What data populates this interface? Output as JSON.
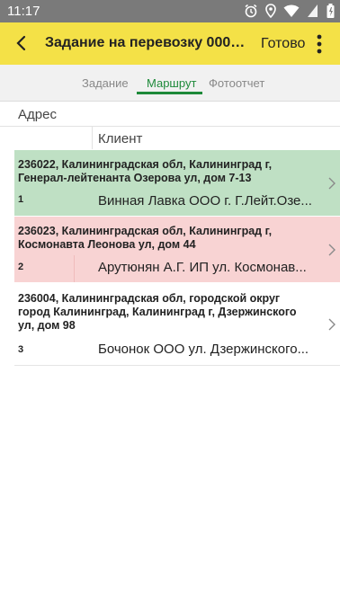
{
  "status_bar": {
    "time": "11:17",
    "icons": [
      "alarm-icon",
      "location-icon",
      "wifi-icon",
      "no-sim-icon",
      "battery-icon"
    ]
  },
  "app_bar": {
    "back_icon": "arrow-left-icon",
    "title": "Задание на перевозку 00000...",
    "done_label": "Готово",
    "menu_icon": "more-vert-icon"
  },
  "tabs": [
    {
      "label": "Задание",
      "active": false
    },
    {
      "label": "Маршрут",
      "active": true
    },
    {
      "label": "Фотоотчет",
      "active": false
    }
  ],
  "table": {
    "header_address": "Адрес",
    "header_client": "Клиент",
    "rows": [
      {
        "address": "236022, Калининградская обл, Калининград г, Генерал-лейтенанта Озерова ул, дом 7-13",
        "number": "1",
        "client": "Винная Лавка ООО г. Г.Лейт.Озе...",
        "status_color": "#bfe0c4"
      },
      {
        "address": "236023, Калининградская обл, Калининград г, Космонавта Леонова ул, дом 44",
        "number": "2",
        "client": "Арутюнян А.Г. ИП ул. Космонав...",
        "status_color": "#f8d3d3"
      },
      {
        "address": "236004, Калининградская обл, городской округ город Калининград, Калининград г, Дзержинского ул, дом 98",
        "number": "3",
        "client": "Бочонок ООО ул. Дзержинского...",
        "status_color": "#ffffff"
      }
    ]
  },
  "colors": {
    "app_bar": "#f4e147",
    "accent": "#1e8a3a",
    "status_bar": "#7a7a7a"
  }
}
